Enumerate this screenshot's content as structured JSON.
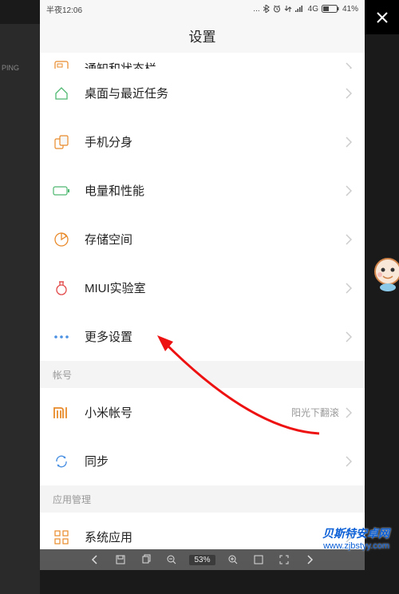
{
  "status": {
    "time": "半夜12:06",
    "network": "4G",
    "battery": "41%"
  },
  "header": {
    "title": "设置"
  },
  "rows": {
    "notifications": "通知和状态栏",
    "desktop": "桌面与最近任务",
    "dual_apps": "手机分身",
    "battery": "电量和性能",
    "storage": "存储空间",
    "miui_lab": "MIUI实验室",
    "more_settings": "更多设置",
    "xiaomi_account": "小米帐号",
    "xiaomi_account_sub": "阳光下翻滚",
    "sync": "同步",
    "system_apps": "系统应用"
  },
  "sections": {
    "account": "帐号",
    "app_management": "应用管理"
  },
  "sidebar": {
    "label": "PING"
  },
  "toolbar": {
    "zoom": "53%"
  },
  "watermark": {
    "title": "贝斯特安卓网",
    "url": "www.zjbstyy.com"
  }
}
